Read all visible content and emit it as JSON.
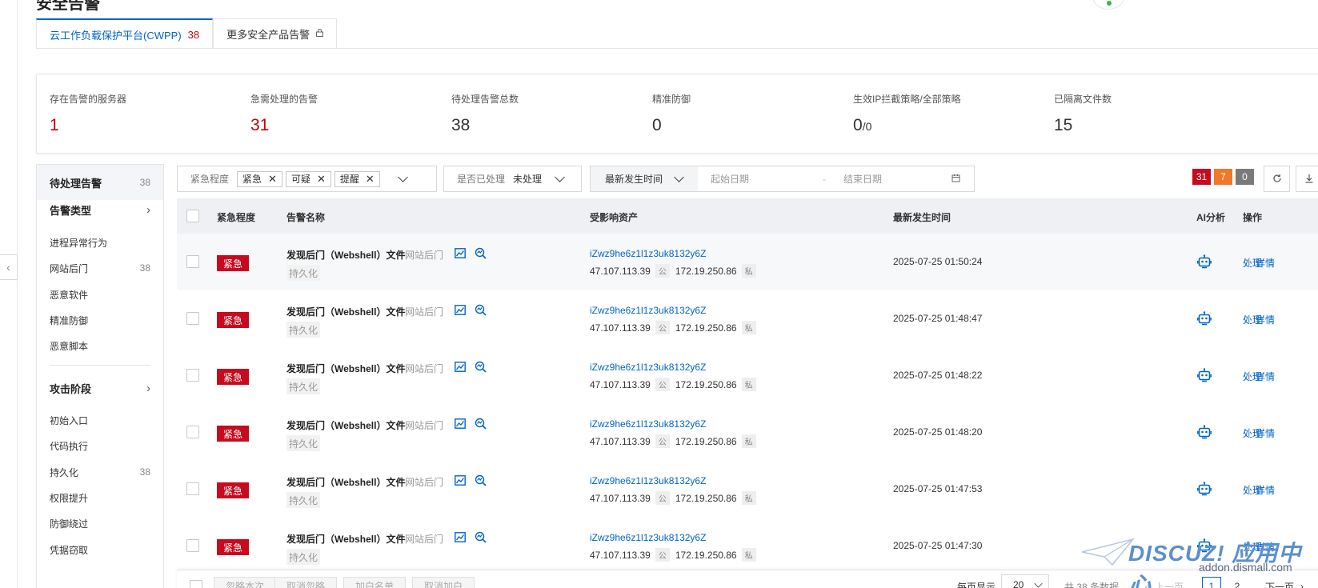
{
  "page": {
    "title": "安全告警"
  },
  "tabs": [
    {
      "label": "云工作负载保护平台(CWPP)",
      "count": "38"
    },
    {
      "label": "更多安全产品告警",
      "icon": "lock-icon"
    }
  ],
  "stats": [
    {
      "label": "存在告警的服务器",
      "value": "1",
      "color": "#c80000"
    },
    {
      "label": "急需处理的告警",
      "value": "31",
      "color": "#c80000"
    },
    {
      "label": "待处理告警总数",
      "value": "38"
    },
    {
      "label": "精准防御",
      "value": "0"
    },
    {
      "label": "生效IP拦截策略/全部策略",
      "value_main": "0",
      "value_sub": "/0"
    },
    {
      "label": "已隔离文件数",
      "value": "15"
    }
  ],
  "sidebar": {
    "pending": {
      "label": "待处理告警",
      "count": "38"
    },
    "type_group": {
      "label": "告警类型"
    },
    "types": [
      {
        "label": "进程异常行为",
        "count": ""
      },
      {
        "label": "网站后门",
        "count": "38"
      },
      {
        "label": "恶意软件",
        "count": ""
      },
      {
        "label": "精准防御",
        "count": ""
      },
      {
        "label": "恶意脚本",
        "count": ""
      }
    ],
    "stage_group": {
      "label": "攻击阶段"
    },
    "stages": [
      {
        "label": "初始入口",
        "count": ""
      },
      {
        "label": "代码执行",
        "count": ""
      },
      {
        "label": "持久化",
        "count": "38"
      },
      {
        "label": "权限提升",
        "count": ""
      },
      {
        "label": "防御绕过",
        "count": ""
      },
      {
        "label": "凭据窃取",
        "count": ""
      }
    ]
  },
  "filters": {
    "severity": {
      "label": "紧急程度",
      "tags": [
        "紧急",
        "可疑",
        "提醒"
      ]
    },
    "handled": {
      "label": "是否已处理",
      "value": "未处理"
    },
    "time": {
      "label": "最新发生时间",
      "start_placeholder": "起始日期",
      "sep": "-",
      "end_placeholder": "结束日期"
    }
  },
  "counts": [
    {
      "value": "31",
      "color": "#c80a1e"
    },
    {
      "value": "7",
      "color": "#f07828"
    },
    {
      "value": "0",
      "color": "#7a7a7a"
    }
  ],
  "table": {
    "headers": {
      "severity": "紧急程度",
      "name": "告警名称",
      "asset": "受影响资产",
      "time": "最新发生时间",
      "ai": "AI分析",
      "ops": "操作"
    },
    "rows": [
      {
        "severity": "紧急",
        "name": "发现后门（Webshell）文件",
        "category": "网站后门",
        "tag": "持久化",
        "host": "iZwz9he6z1l1z3uk8132y6Z",
        "public_ip": "47.107.113.39",
        "public_tag": "公",
        "private_ip": "172.19.250.86",
        "private_tag": "私",
        "time": "2025-07-25 01:50:24",
        "op_handle": "处理",
        "op_detail": "详情"
      },
      {
        "severity": "紧急",
        "name": "发现后门（Webshell）文件",
        "category": "网站后门",
        "tag": "持久化",
        "host": "iZwz9he6z1l1z3uk8132y6Z",
        "public_ip": "47.107.113.39",
        "public_tag": "公",
        "private_ip": "172.19.250.86",
        "private_tag": "私",
        "time": "2025-07-25 01:48:47",
        "op_handle": "处理",
        "op_detail": "详情"
      },
      {
        "severity": "紧急",
        "name": "发现后门（Webshell）文件",
        "category": "网站后门",
        "tag": "持久化",
        "host": "iZwz9he6z1l1z3uk8132y6Z",
        "public_ip": "47.107.113.39",
        "public_tag": "公",
        "private_ip": "172.19.250.86",
        "private_tag": "私",
        "time": "2025-07-25 01:48:22",
        "op_handle": "处理",
        "op_detail": "详情"
      },
      {
        "severity": "紧急",
        "name": "发现后门（Webshell）文件",
        "category": "网站后门",
        "tag": "持久化",
        "host": "iZwz9he6z1l1z3uk8132y6Z",
        "public_ip": "47.107.113.39",
        "public_tag": "公",
        "private_ip": "172.19.250.86",
        "private_tag": "私",
        "time": "2025-07-25 01:48:20",
        "op_handle": "处理",
        "op_detail": "详情"
      },
      {
        "severity": "紧急",
        "name": "发现后门（Webshell）文件",
        "category": "网站后门",
        "tag": "持久化",
        "host": "iZwz9he6z1l1z3uk8132y6Z",
        "public_ip": "47.107.113.39",
        "public_tag": "公",
        "private_ip": "172.19.250.86",
        "private_tag": "私",
        "time": "2025-07-25 01:47:53",
        "op_handle": "处理",
        "op_detail": "详情"
      },
      {
        "severity": "紧急",
        "name": "发现后门（Webshell）文件",
        "category": "网站后门",
        "tag": "持久化",
        "host": "iZwz9he6z1l1z3uk8132y6Z",
        "public_ip": "47.107.113.39",
        "public_tag": "公",
        "private_ip": "172.19.250.86",
        "private_tag": "私",
        "time": "2025-07-25 01:47:30",
        "op_handle": "处理",
        "op_detail": "详情"
      }
    ]
  },
  "footer": {
    "buttons": [
      "忽略本次",
      "取消忽略",
      "加白名单",
      "取消加白"
    ],
    "per_page_label": "每页显示",
    "per_page": "20",
    "total": "共 38 条数据",
    "prev": "上一页",
    "pages": [
      "1",
      "2"
    ],
    "next": "下一页"
  },
  "watermark": {
    "main": "DISCUZ! 应用中心",
    "sub": "addon.dismall.com"
  }
}
